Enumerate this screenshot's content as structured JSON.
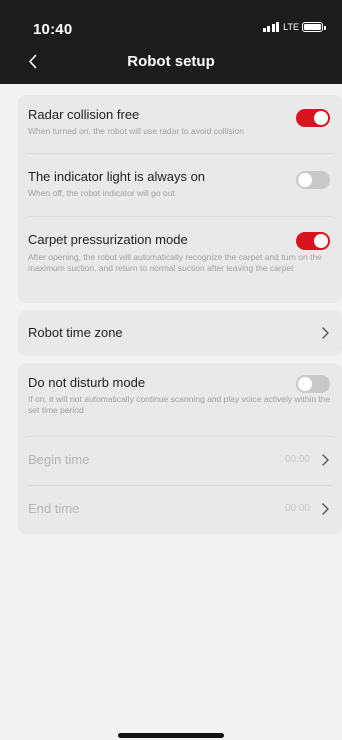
{
  "status_bar": {
    "time": "10:40",
    "network": "LTE"
  },
  "nav": {
    "title": "Robot setup",
    "back_icon": "chevron-left-icon"
  },
  "settings": {
    "radar": {
      "title": "Radar collision free",
      "desc": "When turned on, the robot will use radar to avoid collision",
      "enabled": true
    },
    "indicator": {
      "title": "The indicator light is always on",
      "desc": "When off, the robot indicator will go out",
      "enabled": false
    },
    "carpet": {
      "title": "Carpet pressurization mode",
      "desc": "After opening, the robot will automatically recognize the carpet and turn on the maximum suction, and return to normal suction after leaving the carpet",
      "enabled": true
    },
    "timezone": {
      "title": "Robot time zone"
    },
    "dnd": {
      "title": "Do not disturb mode",
      "desc": "If on, it will not automatically continue scanning and play voice actively within the set time period",
      "enabled": false,
      "begin_label": "Begin time",
      "begin_value": "00:00",
      "end_label": "End time",
      "end_value": "00:00"
    }
  },
  "colors": {
    "header_bg": "#1c1c1c",
    "toggle_on": "#d9141e",
    "toggle_off": "#c9c9c9",
    "card_bg": "#e9e9e9",
    "page_bg": "#f2f2f2"
  }
}
